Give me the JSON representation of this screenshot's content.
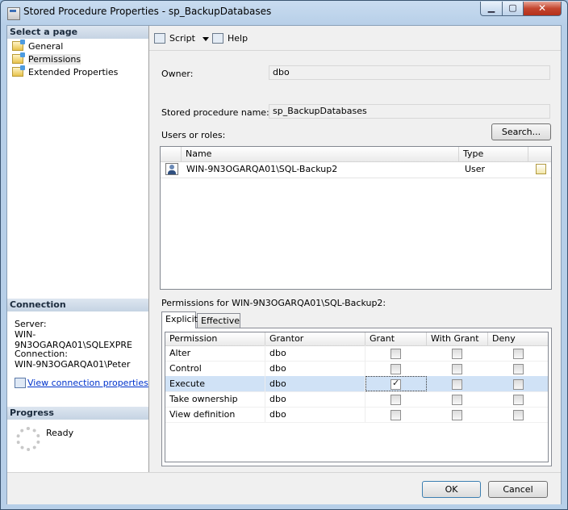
{
  "window": {
    "title": "Stored Procedure Properties - sp_BackupDatabases",
    "minimize": "▁",
    "maximize": "▢",
    "close": "✕"
  },
  "left_panel": {
    "select_page_header": "Select a page",
    "pages": [
      {
        "label": "General"
      },
      {
        "label": "Permissions"
      },
      {
        "label": "Extended Properties"
      }
    ],
    "connection_header": "Connection",
    "server_label": "Server:",
    "server_value": "WIN-9N3OGARQA01\\SQLEXPRE",
    "connection_label": "Connection:",
    "connection_value": "WIN-9N3OGARQA01\\Peter",
    "view_link": "View connection properties",
    "progress_header": "Progress",
    "progress_status": "Ready"
  },
  "toolbar": {
    "script_label": "Script",
    "help_label": "Help"
  },
  "form": {
    "owner_label": "Owner:",
    "owner_value": "dbo",
    "spname_label": "Stored procedure name:",
    "spname_value": "sp_BackupDatabases",
    "users_roles_label": "Users or roles:",
    "search_button": "Search..."
  },
  "users_grid": {
    "headers": {
      "name": "Name",
      "type": "Type"
    },
    "rows": [
      {
        "name": "WIN-9N3OGARQA01\\SQL-Backup2",
        "type": "User"
      }
    ]
  },
  "permissions": {
    "label": "Permissions for WIN-9N3OGARQA01\\SQL-Backup2:",
    "tabs": [
      "Explicit",
      "Effective"
    ],
    "active_tab": "Explicit",
    "headers": {
      "permission": "Permission",
      "grantor": "Grantor",
      "grant": "Grant",
      "with_grant": "With Grant",
      "deny": "Deny"
    },
    "rows": [
      {
        "permission": "Alter",
        "grantor": "dbo",
        "grant": false,
        "with_grant": false,
        "deny": false
      },
      {
        "permission": "Control",
        "grantor": "dbo",
        "grant": false,
        "with_grant": false,
        "deny": false
      },
      {
        "permission": "Execute",
        "grantor": "dbo",
        "grant": true,
        "with_grant": false,
        "deny": false
      },
      {
        "permission": "Take ownership",
        "grantor": "dbo",
        "grant": false,
        "with_grant": false,
        "deny": false
      },
      {
        "permission": "View definition",
        "grantor": "dbo",
        "grant": false,
        "with_grant": false,
        "deny": false
      }
    ]
  },
  "buttons": {
    "ok": "OK",
    "cancel": "Cancel"
  }
}
